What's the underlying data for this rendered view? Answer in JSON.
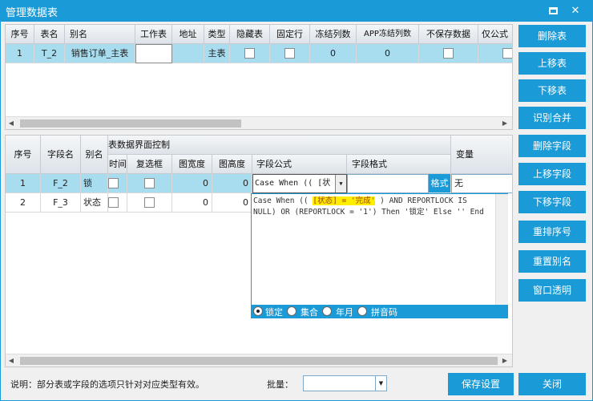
{
  "window": {
    "title": "管理数据表"
  },
  "tables": {
    "headers": [
      "序号",
      "表名",
      "别名",
      "工作表",
      "地址",
      "类型",
      "隐藏表",
      "固定行",
      "冻结列数",
      "APP冻结列数",
      "不保存数据",
      "仅公式"
    ],
    "row": {
      "index": "1",
      "name": "T_2",
      "alias": "销售订单_主表",
      "type": "主表",
      "freeze": "0",
      "app_freeze": "0"
    }
  },
  "fields": {
    "group_header": "表数据界面控制",
    "headers": [
      "序号",
      "字段名",
      "别名",
      "时间",
      "复选框",
      "图宽度",
      "图高度",
      "字段公式",
      "字段格式",
      "变量"
    ],
    "rows": [
      {
        "index": "1",
        "name": "F_2",
        "alias": "锁",
        "img_w": "0",
        "img_h": "0",
        "formula": "Case When (( [状",
        "format_btn": "格式",
        "variable": "无"
      },
      {
        "index": "2",
        "name": "F_3",
        "alias": "状态",
        "img_w": "0",
        "img_h": "0"
      }
    ]
  },
  "formula_popup": {
    "line1_pre": "Case When (( ",
    "line1_hl": "[状态] = '完成'",
    "line1_post": " ) AND REPORTLOCK IS",
    "line2": "NULL) OR (REPORTLOCK = '1') Then '锁定' Else '' End",
    "options": [
      {
        "label": "锁定",
        "selected": true
      },
      {
        "label": "集合",
        "selected": false
      },
      {
        "label": "年月",
        "selected": false
      },
      {
        "label": "拼音码",
        "selected": false
      }
    ]
  },
  "side_buttons": {
    "delete_table": "删除表",
    "move_table_up": "上移表",
    "move_table_down": "下移表",
    "detect_merge": "识别合并",
    "delete_field": "删除字段",
    "move_field_up": "上移字段",
    "move_field_down": "下移字段",
    "renumber": "重排序号",
    "reset_alias": "重置别名",
    "window_transparent": "窗口透明"
  },
  "footer": {
    "note": "说明：部分表或字段的选项只针对对应类型有效。",
    "batch_label": "批量：",
    "batch_value": "",
    "save": "保存设置",
    "close": "关闭"
  },
  "colors": {
    "accent": "#1a9bd7",
    "selected_row": "#a8dcef",
    "highlight": "#ffee00"
  }
}
